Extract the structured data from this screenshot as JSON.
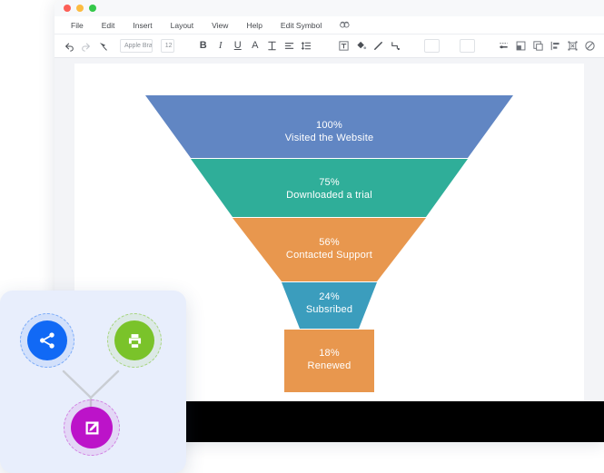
{
  "window": {
    "traffic_lights": [
      "close",
      "minimize",
      "maximize"
    ],
    "menu": [
      {
        "label": "File"
      },
      {
        "label": "Edit"
      },
      {
        "label": "Insert"
      },
      {
        "label": "Layout"
      },
      {
        "label": "View"
      },
      {
        "label": "Help"
      },
      {
        "label": "Edit Symbol"
      }
    ],
    "menu_extra_icon": "symbol-library-icon"
  },
  "toolbar": {
    "undo_icon": "undo-icon",
    "redo_icon": "redo-icon",
    "format_painter_icon": "format-painter-icon",
    "font_family": "Apple Braille",
    "font_size": "12",
    "bold_label": "B",
    "italic_label": "I",
    "underline_label": "U",
    "font_color_label": "A",
    "text_style_label": "T",
    "align_icon": "align-left-icon",
    "line_spacing_icon": "line-spacing-icon",
    "text_box_icon": "text-box-icon",
    "fill_color_icon": "fill-bucket-icon",
    "line_style_icon": "line-icon",
    "connector_icon": "connector-icon",
    "field_one_value": "",
    "field_two_value": "",
    "stroke_width_icon": "stroke-width-icon",
    "group_icon": "group-icon",
    "duplicate_icon": "duplicate-icon",
    "distribute_icon": "distribute-icon",
    "crop_icon": "crop-icon",
    "no_fill_icon": "no-fill-icon"
  },
  "chart_data": {
    "type": "funnel",
    "title": "",
    "categories": [
      "Visited the Website",
      "Downloaded a trial",
      "Contacted Support",
      "Subsribed",
      "Renewed"
    ],
    "values": [
      100,
      75,
      56,
      24,
      18
    ],
    "value_labels": [
      "100%",
      "75%",
      "56%",
      "24%",
      "18%"
    ],
    "colors": [
      "#6186c3",
      "#2fae99",
      "#e8974e",
      "#3b9dbd",
      "#e8974e"
    ],
    "label_color": "#ffffff",
    "ylim": [
      0,
      100
    ],
    "segments": [
      {
        "percent": "100%",
        "name": "Visited the Website",
        "color": "#6186c3"
      },
      {
        "percent": "75%",
        "name": "Downloaded a trial",
        "color": "#2fae99"
      },
      {
        "percent": "56%",
        "name": "Contacted Support",
        "color": "#e8974e"
      },
      {
        "percent": "24%",
        "name": "Subsribed",
        "color": "#3b9dbd"
      },
      {
        "percent": "18%",
        "name": "Renewed",
        "color": "#e8974e"
      }
    ]
  },
  "widget_panel": {
    "background": "#e8eefc",
    "nodes": [
      {
        "id": "share",
        "icon": "share-icon",
        "color": "#1169f5"
      },
      {
        "id": "print",
        "icon": "printer-icon",
        "color": "#7ac32a"
      },
      {
        "id": "edit",
        "icon": "edit-square-icon",
        "color": "#bc13c9"
      }
    ]
  }
}
